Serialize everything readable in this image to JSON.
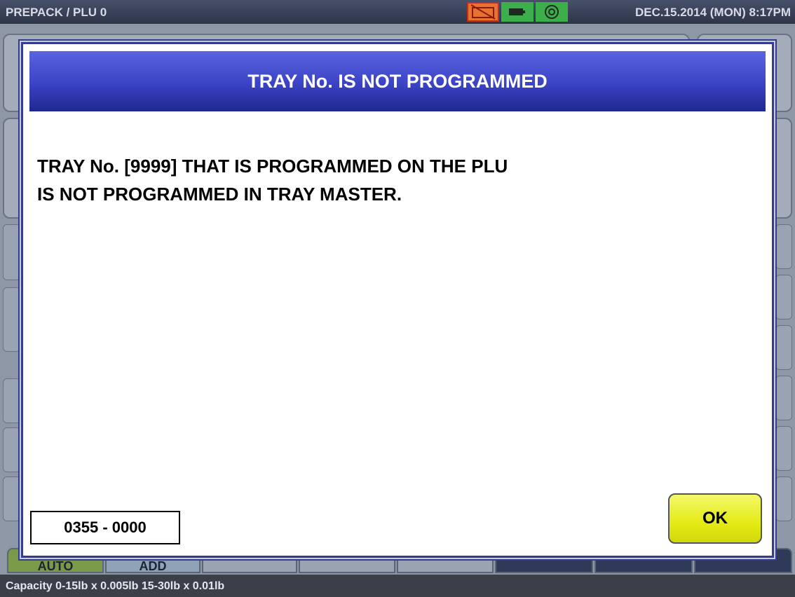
{
  "header": {
    "title": "PREPACK / PLU 0",
    "datetime": "DEC.15.2014 (MON)   8:17PM",
    "status_icons": [
      "printer-error-icon",
      "battery-icon",
      "network-icon"
    ]
  },
  "dialog": {
    "title": "TRAY No. IS NOT PROGRAMMED",
    "message_line1": "TRAY No. [9999] THAT IS PROGRAMMED ON THE PLU",
    "message_line2": "IS NOT PROGRAMMED IN TRAY MASTER.",
    "error_code": "0355 - 0000",
    "ok_label": "OK"
  },
  "bottom_keys": {
    "auto_label": "AUTO",
    "add_label": "ADD"
  },
  "footer": {
    "capacity": "Capacity 0-15lb x 0.005lb  15-30lb x 0.01lb"
  },
  "colors": {
    "dialog_header": "#3a43c4",
    "ok_button": "#e3ea14",
    "auto_key": "#7a9a4a"
  }
}
